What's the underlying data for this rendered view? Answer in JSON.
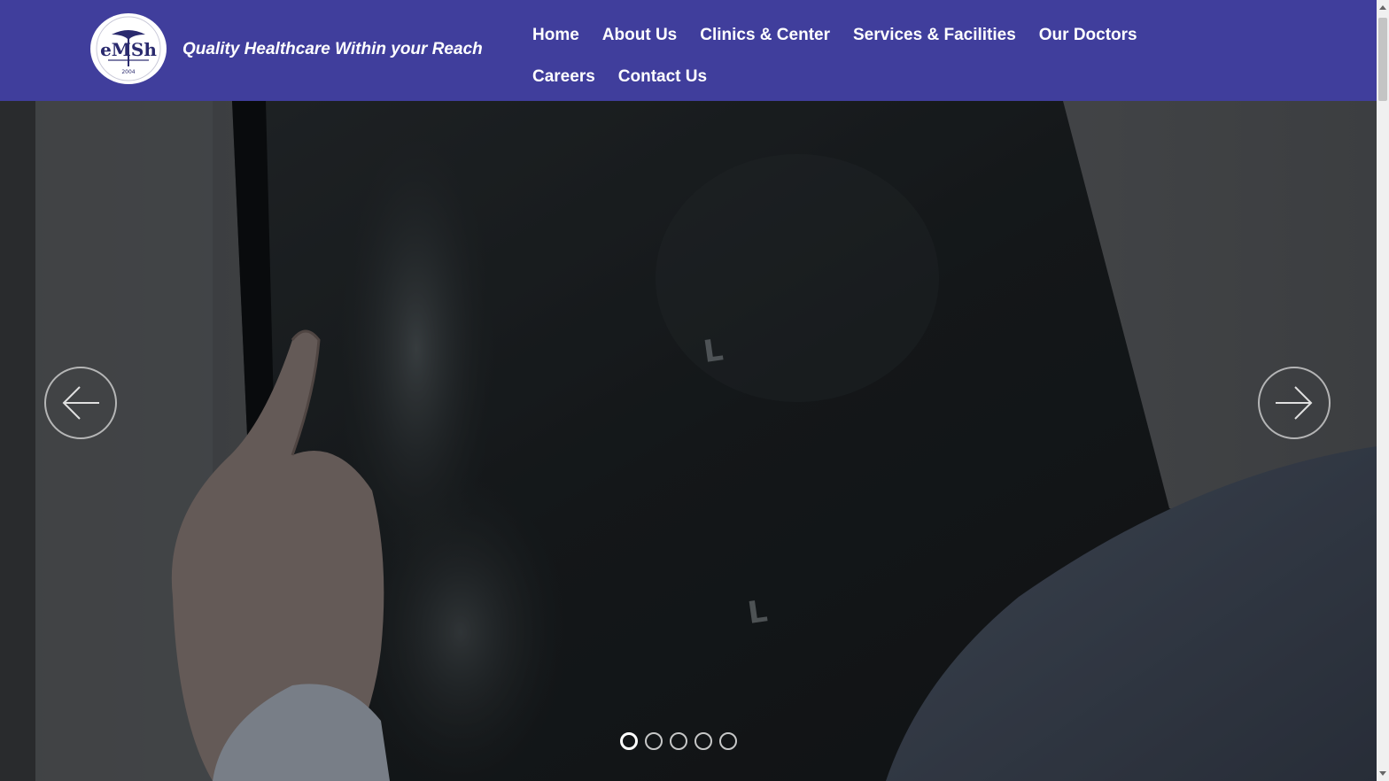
{
  "header": {
    "logo": {
      "text": "eMSh",
      "year": "2004",
      "icon": "caduceus-logo-icon"
    },
    "tagline": "Quality Healthcare Within your Reach"
  },
  "nav": {
    "items": [
      {
        "label": "Home"
      },
      {
        "label": "About Us"
      },
      {
        "label": "Clinics & Center"
      },
      {
        "label": "Services & Facilities"
      },
      {
        "label": "Our Doctors"
      },
      {
        "label": "Careers"
      },
      {
        "label": "Contact Us"
      }
    ]
  },
  "slider": {
    "prev_icon": "arrow-left-icon",
    "next_icon": "arrow-right-icon",
    "slide_count": 5,
    "active_index": 0,
    "xray_labels": [
      "L",
      "L"
    ]
  },
  "colors": {
    "header_bg": "#403e9c",
    "nav_text": "#ffffff"
  }
}
